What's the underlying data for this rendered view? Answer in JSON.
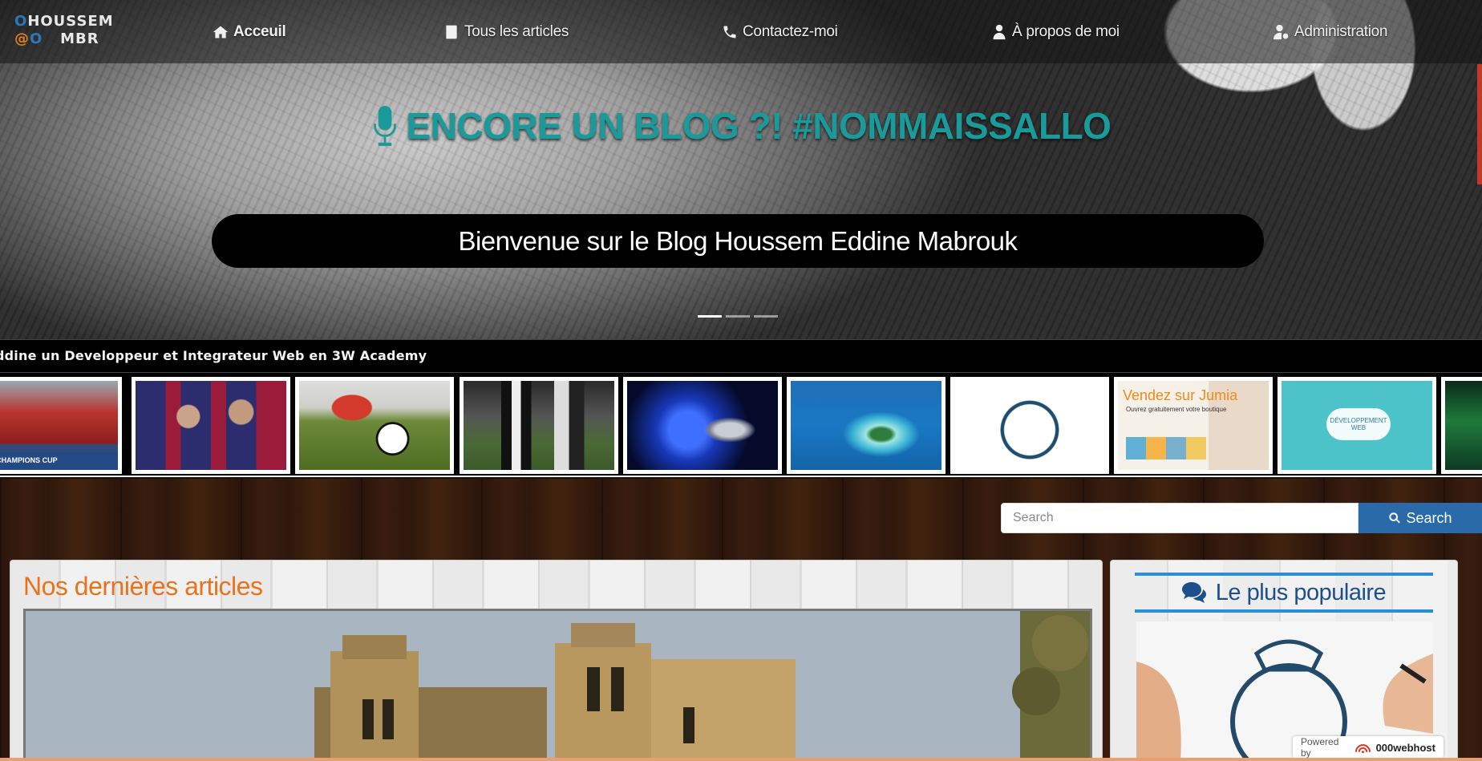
{
  "logo": {
    "line1_a": "O",
    "line1_b": "HOUSSEM",
    "line2_a": "@",
    "line2_b": "O",
    "line2_c": "MBR"
  },
  "nav": {
    "items": [
      {
        "label": "Acceuil",
        "icon": "home-icon"
      },
      {
        "label": "Tous les articles",
        "icon": "book-icon"
      },
      {
        "label": "Contactez-moi",
        "icon": "phone-icon"
      },
      {
        "label": "À propos de moi",
        "icon": "user-tie-icon"
      },
      {
        "label": "Administration",
        "icon": "user-cog-icon"
      }
    ]
  },
  "hero": {
    "headline": "ENCORE UN BLOG ?! #NOMMAISSALLO",
    "welcome": "Bienvenue sur le Blog Houssem Eddine Mabrouk",
    "slides_total": 3,
    "active_slide": 1
  },
  "ticker": {
    "text": "ddine un Developpeur et Integrateur Web en 3W Academy"
  },
  "thumbnails": [
    {
      "icon": "team-photo-image",
      "caption": "ZAYED CHAMPIONS CUP"
    },
    {
      "icon": "messi-coutinho-image",
      "caption": ""
    },
    {
      "icon": "football-kick-image",
      "caption": ""
    },
    {
      "icon": "juventus-ajax-image",
      "caption": ""
    },
    {
      "icon": "champions-trophy-image",
      "caption": ""
    },
    {
      "icon": "island-plane-image",
      "caption": ""
    },
    {
      "icon": "real-madrid-logo-image",
      "caption": ""
    },
    {
      "icon": "jumia-ad-image",
      "caption": "Vendez sur Jumia",
      "subcaption": "Ouvrez gratuitement votre boutique"
    },
    {
      "icon": "web-dev-diagram-image",
      "caption": "DÉVELOPPEMENT WEB"
    },
    {
      "icon": "aurora-image",
      "caption": ""
    }
  ],
  "search": {
    "placeholder": "Search",
    "button": "Search"
  },
  "main": {
    "title": "Nos dernières articles"
  },
  "sidebar": {
    "title": "Le plus populaire"
  },
  "powered": {
    "prefix": "Powered by",
    "brand": "000webhost"
  },
  "colors": {
    "accent_teal": "#1a9a9a",
    "accent_orange": "#e8731c",
    "accent_blue": "#2b6aa8"
  }
}
